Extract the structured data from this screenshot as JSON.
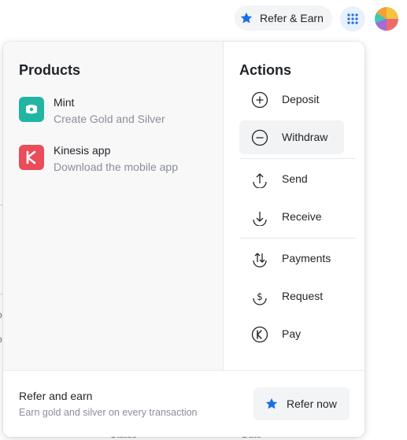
{
  "topbar": {
    "refer_label": "Refer & Earn"
  },
  "background_fragments": {
    "left_fragment_1": "o",
    "left_fragment_2": "o",
    "bottom_col_1": "Status",
    "bottom_col_2": "Date"
  },
  "products": {
    "title": "Products",
    "items": [
      {
        "name": "Mint",
        "description": "Create Gold and Silver",
        "icon": "mint-logo-icon",
        "color": "#22b5a3"
      },
      {
        "name": "Kinesis app",
        "description": "Download the mobile app",
        "icon": "kinesis-logo-icon",
        "color": "#ea4c5a"
      }
    ]
  },
  "actions": {
    "title": "Actions",
    "items": [
      {
        "label": "Deposit",
        "icon": "plus-circle-icon"
      },
      {
        "label": "Withdraw",
        "icon": "minus-circle-icon",
        "active": true
      },
      {
        "label": "Send",
        "icon": "send-icon"
      },
      {
        "label": "Receive",
        "icon": "receive-icon"
      },
      {
        "label": "Payments",
        "icon": "payments-icon"
      },
      {
        "label": "Request",
        "icon": "request-dollar-icon"
      },
      {
        "label": "Pay",
        "icon": "pay-kinesis-icon"
      }
    ]
  },
  "footer": {
    "title": "Refer and earn",
    "description": "Earn gold and silver on every transaction",
    "button_label": "Refer now"
  },
  "colors": {
    "accent": "#1a6fe8",
    "mint": "#22b5a3",
    "kinesis": "#ea4c5a"
  }
}
